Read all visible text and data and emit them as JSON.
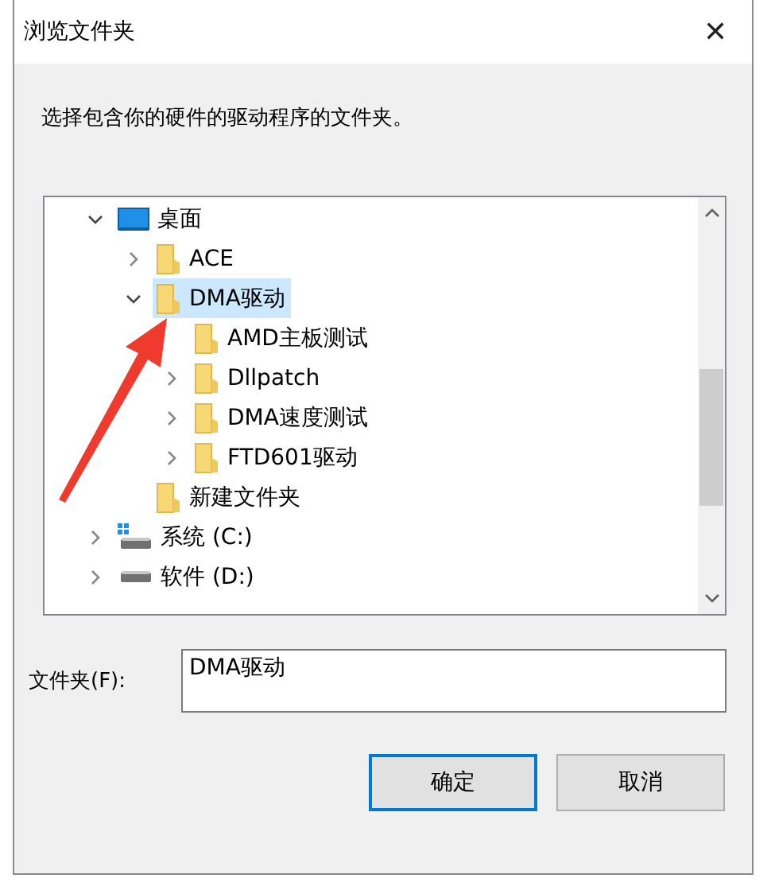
{
  "window": {
    "title": "浏览文件夹",
    "close": "✕"
  },
  "instruction": "选择包含你的硬件的驱动程序的文件夹。",
  "tree": [
    {
      "label": "桌面",
      "kind": "desktop",
      "expandable": true,
      "expanded": true,
      "selected": false,
      "children": [
        {
          "label": "ACE",
          "kind": "folder",
          "expandable": true,
          "expanded": false,
          "selected": false
        },
        {
          "label": "DMA驱动",
          "kind": "folder",
          "expandable": true,
          "expanded": true,
          "selected": true,
          "children": [
            {
              "label": "AMD主板测试",
              "kind": "folder",
              "expandable": false,
              "selected": false
            },
            {
              "label": "Dllpatch",
              "kind": "folder",
              "expandable": true,
              "expanded": false,
              "selected": false
            },
            {
              "label": "DMA速度测试",
              "kind": "folder",
              "expandable": true,
              "expanded": false,
              "selected": false
            },
            {
              "label": "FTD601驱动",
              "kind": "folder",
              "expandable": true,
              "expanded": false,
              "selected": false
            }
          ]
        },
        {
          "label": "新建文件夹",
          "kind": "folder",
          "expandable": false,
          "selected": false
        }
      ]
    },
    {
      "label": "系统 (C:)",
      "kind": "system-drive",
      "expandable": true,
      "expanded": false,
      "selected": false
    },
    {
      "label": "软件 (D:)",
      "kind": "drive",
      "expandable": true,
      "expanded": false,
      "selected": false
    }
  ],
  "folder_field": {
    "label": "文件夹(F):",
    "value": "DMA驱动"
  },
  "buttons": [
    {
      "label": "确定",
      "default": true
    },
    {
      "label": "取消",
      "default": false
    }
  ]
}
